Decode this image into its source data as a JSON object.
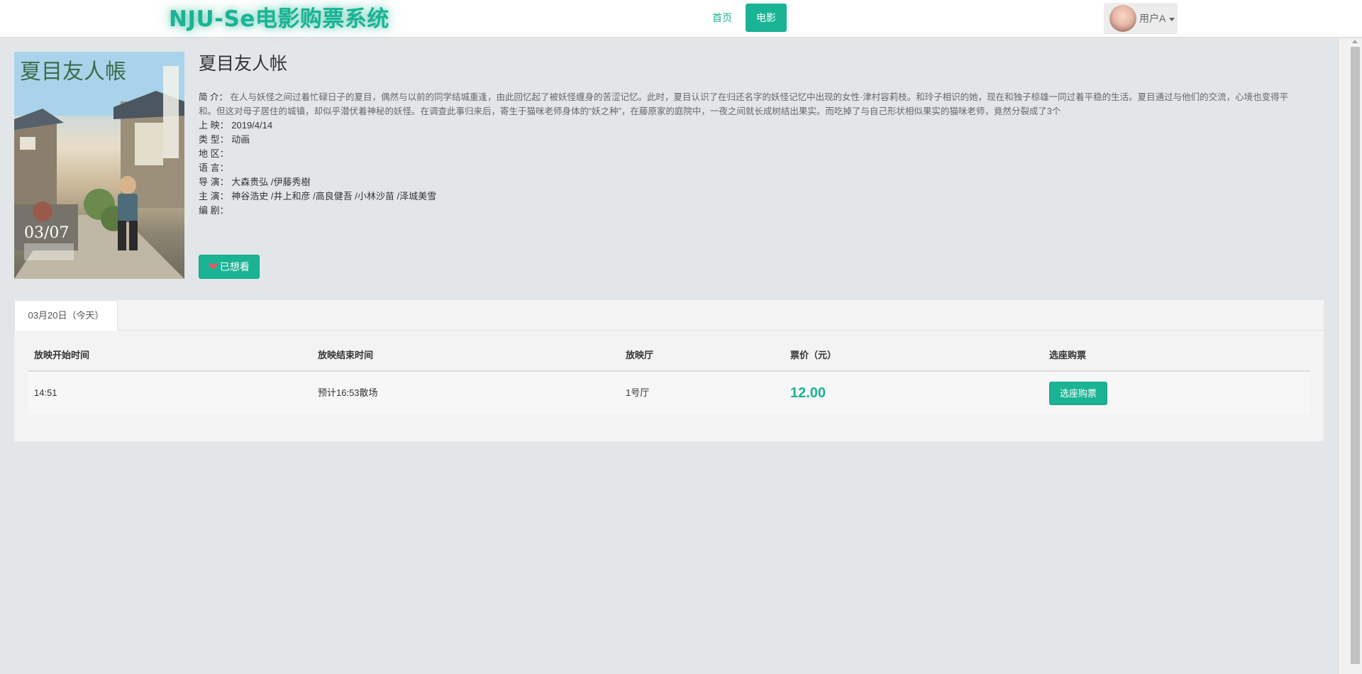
{
  "header": {
    "brand": "NJU-Se电影购票系统",
    "nav_home": "首页",
    "nav_movie": "电影",
    "user_name": "用户A"
  },
  "movie": {
    "title": "夏目友人帐",
    "desc_label": "简 介：",
    "desc": "在人与妖怪之间过着忙碌日子的夏目，偶然与以前的同学结城重逢，由此回忆起了被妖怪缠身的苦涩记忆。此时，夏目认识了在归还名字的妖怪记忆中出现的女性·津村容莉枝。和玲子相识的她，现在和独子椋雄一同过着平稳的生活。夏目通过与他们的交流，心境也变得平和。但这对母子居住的城镇，却似乎潜伏着神秘的妖怪。在调查此事归来后，寄生于猫咪老师身体的“妖之种”，在藤原家的庭院中，一夜之间就长成树结出果实。而吃掉了与自己形状相似果实的猫咪老师，竟然分裂成了3个",
    "release_label": "上 映：",
    "release": "2019/4/14",
    "type_label": "类 型：",
    "type": "动画",
    "region_label": "地 区：",
    "region": "",
    "language_label": "语 言：",
    "language": "",
    "director_label": "导 演：",
    "director": "大森贵弘 /伊藤秀樹",
    "cast_label": "主 演：",
    "cast": "神谷浩史 /井上和彦 /高良健吾 /小林沙苗 /泽城美雪",
    "writer_label": "编 剧：",
    "writer": "",
    "want_button": "已想看",
    "poster": {
      "title_text": "夏目友人帳",
      "date_text": "03/07"
    }
  },
  "schedule": {
    "tab_label": "03月20日（今天）",
    "columns": [
      "放映开始时间",
      "放映结束时间",
      "放映厅",
      "票价（元）",
      "选座购票"
    ],
    "rows": [
      {
        "start": "14:51",
        "end": "预计16:53散场",
        "hall": "1号厅",
        "price": "12.00",
        "action": "选座购票"
      }
    ]
  },
  "colors": {
    "accent": "#1ab394",
    "background": "#e3e6e8",
    "heart": "#ed5565"
  }
}
